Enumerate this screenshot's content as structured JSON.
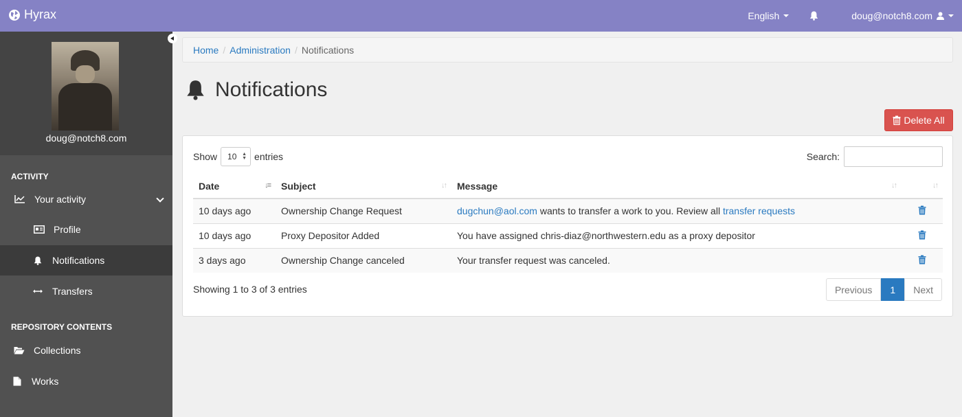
{
  "navbar": {
    "brand": "Hyrax",
    "language": "English",
    "user": "doug@notch8.com"
  },
  "sidebar": {
    "user_name": "doug@notch8.com",
    "sections": [
      {
        "heading": "ACTIVITY"
      },
      {
        "heading": "REPOSITORY CONTENTS"
      }
    ],
    "items": [
      {
        "label": "Your activity",
        "icon": "chart-line-icon"
      },
      {
        "label": "Profile",
        "icon": "id-card-icon"
      },
      {
        "label": "Notifications",
        "icon": "bell-icon",
        "active": true
      },
      {
        "label": "Transfers",
        "icon": "arrows-horizontal-icon"
      },
      {
        "label": "Collections",
        "icon": "folder-open-icon"
      },
      {
        "label": "Works",
        "icon": "file-icon"
      }
    ]
  },
  "breadcrumb": {
    "items": [
      "Home",
      "Administration",
      "Notifications"
    ]
  },
  "page": {
    "title": "Notifications",
    "delete_all_label": "Delete All"
  },
  "table_controls": {
    "show_label": "Show",
    "entries_value": "10",
    "entries_label": "entries",
    "search_label": "Search:",
    "search_value": ""
  },
  "table": {
    "columns": [
      "Date",
      "Subject",
      "Message"
    ],
    "rows": [
      {
        "date": "10 days ago",
        "subject": "Ownership Change Request",
        "message_link": "dugchun@aol.com",
        "message_text": " wants to transfer a work to you. Review all ",
        "message_link2": "transfer requests"
      },
      {
        "date": "10 days ago",
        "subject": "Proxy Depositor Added",
        "message_text": "You have assigned chris-diaz@northwestern.edu as a proxy depositor"
      },
      {
        "date": "3 days ago",
        "subject": "Ownership Change canceled",
        "message_text": "Your transfer request was canceled."
      }
    ]
  },
  "footer": {
    "info": "Showing 1 to 3 of 3 entries",
    "pager": {
      "previous": "Previous",
      "current": "1",
      "next": "Next"
    }
  },
  "colors": {
    "navbar": "#8582c5",
    "sidebar": "#515151",
    "link": "#2a7ac0",
    "danger": "#d9534f"
  }
}
